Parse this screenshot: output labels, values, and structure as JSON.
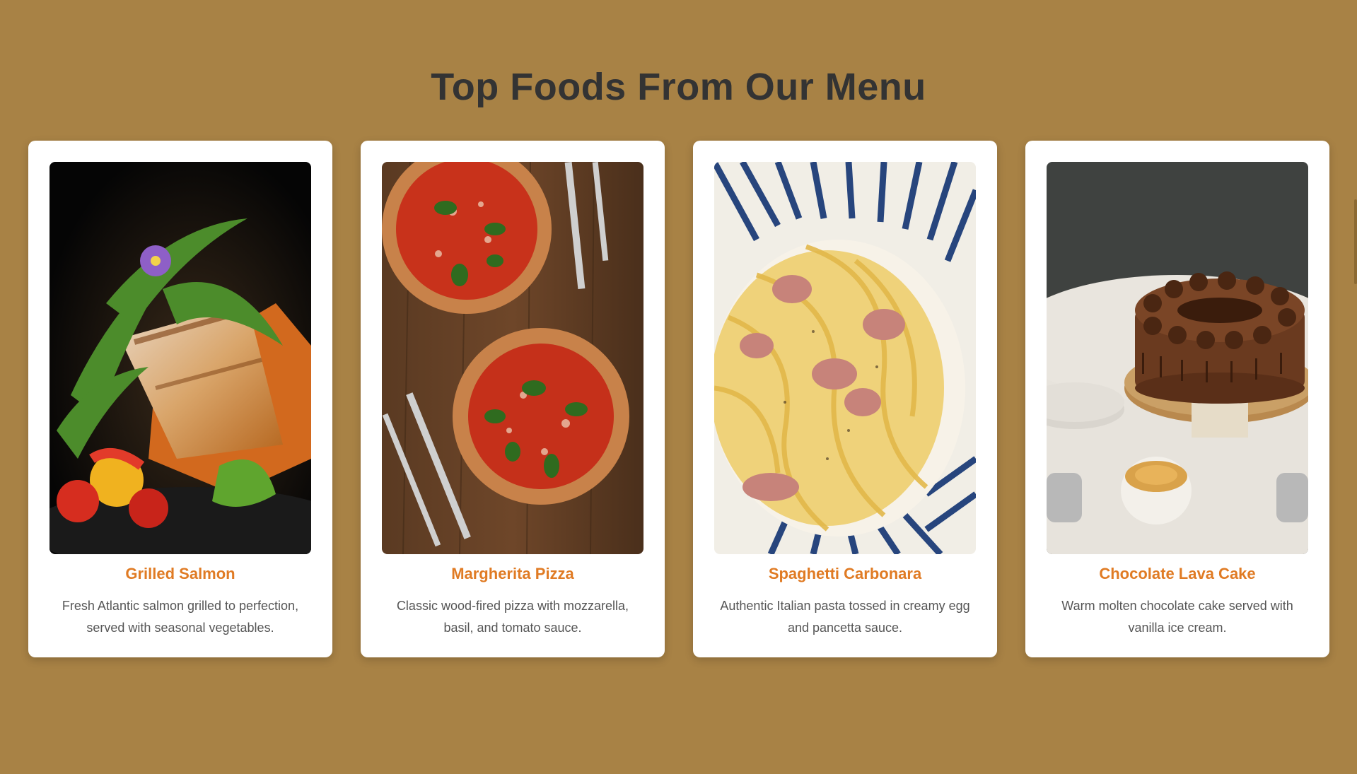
{
  "section": {
    "title": "Top Foods From Our Menu"
  },
  "theme": {
    "background": "#a88245",
    "title_color": "#333333",
    "accent": "#e07b24",
    "text_color": "#555555"
  },
  "menu_items": [
    {
      "name": "Grilled Salmon",
      "description": "Fresh Atlantic salmon grilled to perfection, served with seasonal vegetables.",
      "image": "grilled-salmon-photo"
    },
    {
      "name": "Margherita Pizza",
      "description": "Classic wood-fired pizza with mozzarella, basil, and tomato sauce.",
      "image": "margherita-pizza-photo"
    },
    {
      "name": "Spaghetti Carbonara",
      "description": "Authentic Italian pasta tossed in creamy egg and pancetta sauce.",
      "image": "spaghetti-carbonara-photo"
    },
    {
      "name": "Chocolate Lava Cake",
      "description": "Warm molten chocolate cake served with vanilla ice cream.",
      "image": "chocolate-lava-cake-photo"
    }
  ]
}
